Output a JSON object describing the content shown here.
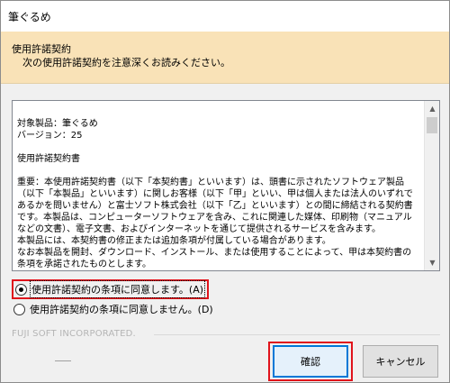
{
  "window": {
    "title": "筆ぐるめ"
  },
  "header": {
    "title": "使用許諾契約",
    "subtitle": "次の使用許諾契約を注意深くお読みください。"
  },
  "license": {
    "lines": [
      "対象製品：筆ぐるめ",
      "バージョン：25",
      "",
      "使用許諾契約書",
      "",
      "重要：本使用許諾契約書（以下「本契約書」といいます）は、頭書に示されたソフトウェア製品（以下「本製品」といいます）に関しお客様（以下「甲」といい、甲は個人または法人のいずれであるかを問いません）と富士ソフト株式会社（以下「乙」といいます）との間に締結される契約書です。本製品は、コンピューターソフトウェアを含み、これに関連した媒体、印刷物（マニュアルなどの文書）、電子文書、およびインターネットを通じて提供されるサービスを含みます。",
      "本製品には、本契約書の修正または追加条項が付属している場合があります。",
      "なお本製品を開封、ダウンロード、インストール、または使用することによって、甲は本契約書の条項を承諾されたものとします。"
    ]
  },
  "options": {
    "agree": "使用許諾契約の条項に同意します。(A)",
    "disagree": "使用許諾契約の条項に同意しません。(D)",
    "selected": "agree"
  },
  "footer": {
    "brand": "FUJI SOFT INCORPORATED.",
    "ok_label": "確認",
    "cancel_label": "キャンセル"
  }
}
